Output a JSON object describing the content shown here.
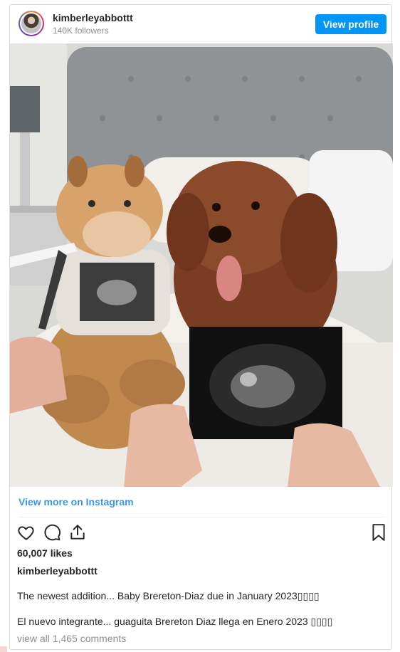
{
  "header": {
    "username": "kimberleyabbottt",
    "followers": "140K followers",
    "view_profile_label": "View profile"
  },
  "post": {
    "image_alt": "Dog and plush giraffe with ultrasound scans on a bed"
  },
  "footer": {
    "view_more_label": "View more on Instagram",
    "likes": "60,007 likes",
    "owner": "kimberleyabbottt",
    "caption_en": "The newest addition... Baby Brereton-Diaz due in January 2023▯▯▯▯",
    "caption_es": "El nuevo integrante... guaguita Brereton Diaz llega en Enero 2023 ▯▯▯▯",
    "comments_link": "view all 1,465 comments"
  },
  "icons": {
    "like": "heart-icon",
    "comment": "comment-bubble-icon",
    "share": "share-icon",
    "save": "bookmark-icon"
  },
  "colors": {
    "accent": "#0095f6",
    "link": "#3897f0",
    "muted": "#8e8e8e"
  }
}
